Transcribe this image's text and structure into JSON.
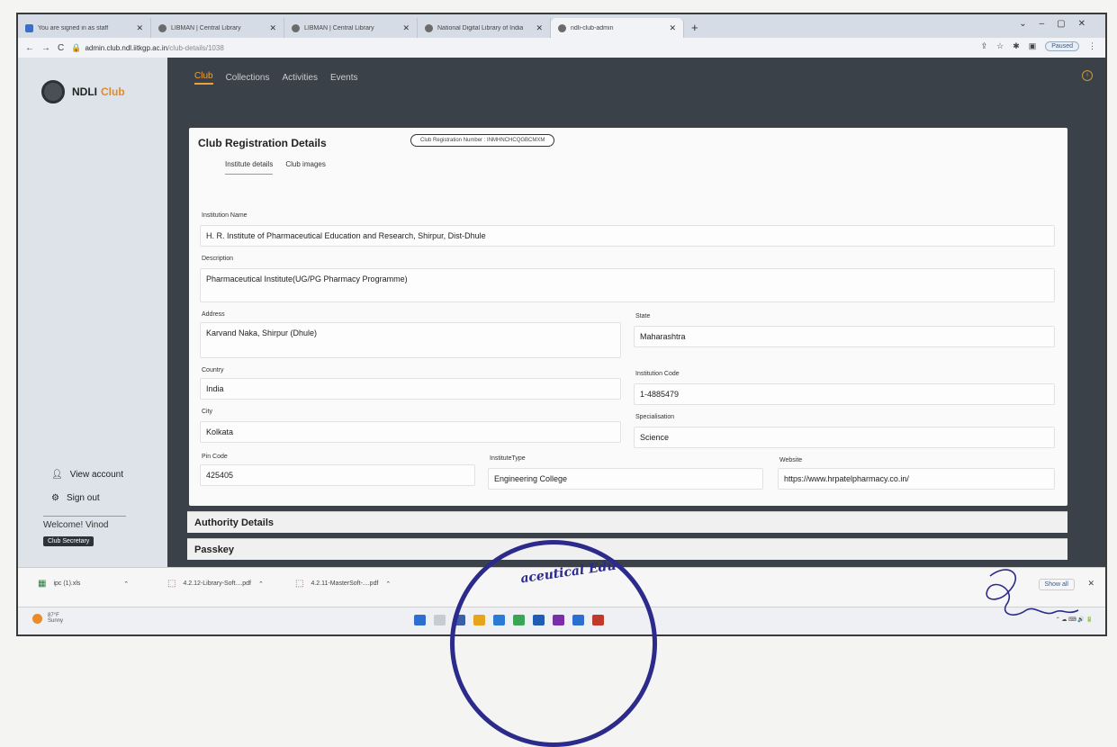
{
  "browser": {
    "tabs": [
      {
        "title": "You are signed in as staff"
      },
      {
        "title": "LIBMAN | Central Library"
      },
      {
        "title": "LIBMAN | Central Library"
      },
      {
        "title": "National Digital Library of India"
      },
      {
        "title": "ndli-club-admin",
        "active": true
      }
    ],
    "new_tab": "+",
    "url_host": "admin.club.ndl.iitkgp.ac.in",
    "url_path": "/club-details/1038",
    "profile_status": "Paused"
  },
  "sidebar": {
    "brand": "NDLI",
    "brand_accent": "Club",
    "view_account": "View account",
    "sign_out": "Sign out",
    "welcome": "Welcome! Vinod",
    "role_badge": "Club Secretary"
  },
  "topnav": {
    "items": [
      "Club",
      "Collections",
      "Activities",
      "Events"
    ],
    "active": "Club"
  },
  "registration": {
    "title": "Club Registration Details",
    "reg_number": "Club Registration Number : INMHNCHCQGBCMXM",
    "tabs": [
      "Institute details",
      "Club images"
    ]
  },
  "form": {
    "institution_name_label": "Institution Name",
    "institution_name": "H. R. Institute of Pharmaceutical Education and Research, Shirpur, Dist-Dhule",
    "description_label": "Description",
    "description": "Pharmaceutical Institute(UG/PG Pharmacy Programme)",
    "address_label": "Address",
    "address": "Karvand Naka, Shirpur (Dhule)",
    "state_label": "State",
    "state": "Maharashtra",
    "country_label": "Country",
    "country": "India",
    "institution_code_label": "Institution Code",
    "institution_code": "1-4885479",
    "city_label": "City",
    "city": "Kolkata",
    "specialisation_label": "Specialisation",
    "specialisation": "Science",
    "pin_code_label": "Pin Code",
    "pin_code": "425405",
    "institute_type_label": "InstituteType",
    "institute_type": "Engineering College",
    "website_label": "Website",
    "website": "https://www.hrpatelpharmacy.co.in/"
  },
  "sections": {
    "authority": "Authority Details",
    "passkey": "Passkey"
  },
  "downloads": {
    "files": [
      "ipc (1).xls",
      "4.2.12-Library-Soft....pdf",
      "4.2.11-MasterSoft-....pdf"
    ],
    "show_all": "Show all"
  },
  "taskbar": {
    "weather_temp": "87°F",
    "weather_desc": "Sunny"
  },
  "stamp": {
    "text": "aceutical Edu"
  },
  "colors": {
    "accent": "#e08b2a",
    "dark_panel": "#3b4148",
    "stamp_ink": "#2c2a8a"
  }
}
